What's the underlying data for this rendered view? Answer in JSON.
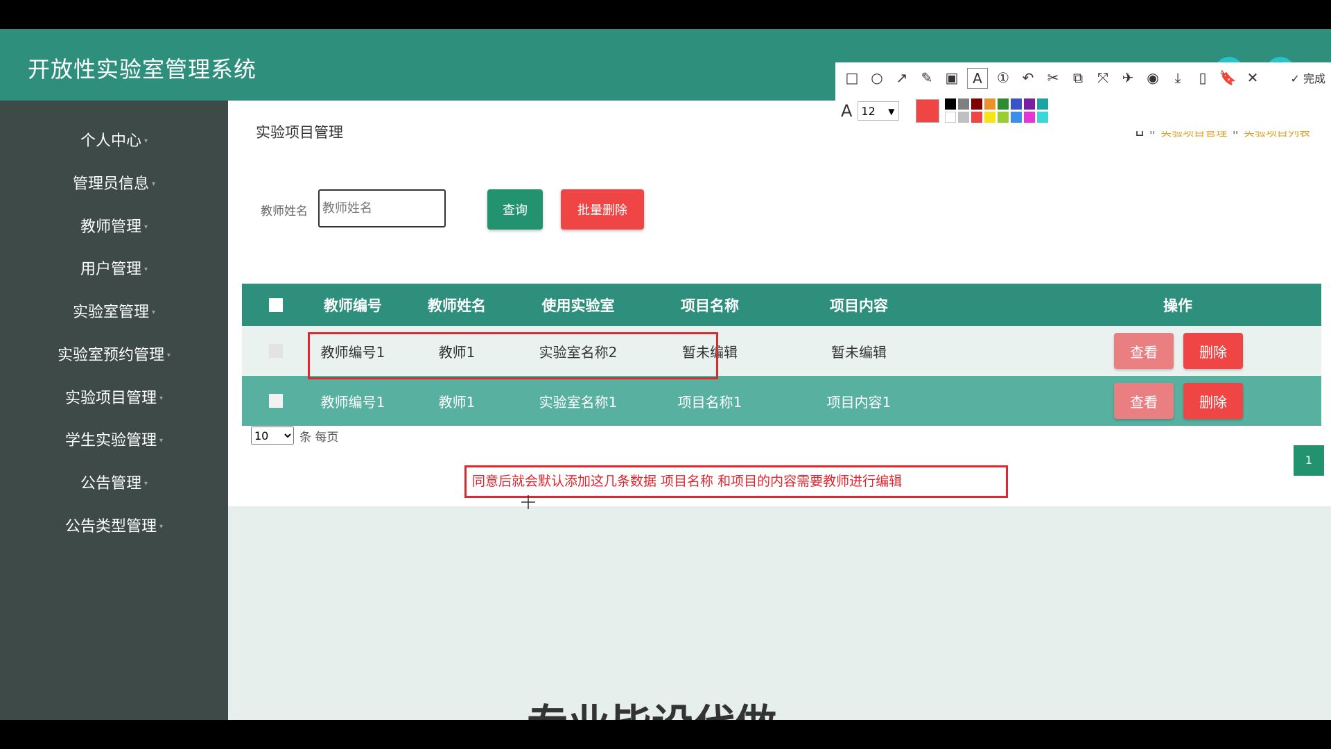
{
  "app": {
    "title": "开放性实验室管理系统"
  },
  "sidebar": {
    "items": [
      {
        "label": "个人中心"
      },
      {
        "label": "管理员信息"
      },
      {
        "label": "教师管理"
      },
      {
        "label": "用户管理"
      },
      {
        "label": "实验室管理"
      },
      {
        "label": "实验室预约管理"
      },
      {
        "label": "实验项目管理"
      },
      {
        "label": "学生实验管理"
      },
      {
        "label": "公告管理"
      },
      {
        "label": "公告类型管理"
      }
    ]
  },
  "page": {
    "title": "实验项目管理",
    "breadcrumb": [
      "实验项目管理",
      "实验项目列表"
    ],
    "search_label": "教师姓名",
    "search_placeholder": "教师姓名",
    "query_button": "查询",
    "batch_delete_button": "批量删除"
  },
  "table": {
    "headers": [
      "教师编号",
      "教师姓名",
      "使用实验室",
      "项目名称",
      "项目内容",
      "操作"
    ],
    "rows": [
      {
        "teacher_no": "教师编号1",
        "teacher_name": "教师1",
        "lab": "实验室名称2",
        "project_name": "暂未编辑",
        "project_content": "暂未编辑"
      },
      {
        "teacher_no": "教师编号1",
        "teacher_name": "教师1",
        "lab": "实验室名称1",
        "project_name": "项目名称1",
        "project_content": "项目内容1"
      }
    ],
    "view_label": "查看",
    "delete_label": "删除"
  },
  "pager": {
    "page_size": "10",
    "unit": "条 每页",
    "current_page": "1"
  },
  "annotation": "同意后就会默认添加这几条数据 项目名称 和项目的内容需要教师进行编辑",
  "toolbar": {
    "done": "完成",
    "font_size": "12"
  },
  "watermark": "专业毕设代做",
  "colors": {
    "primary": "#2f8f7d",
    "danger": "#f04545",
    "annotation": "#e0262e",
    "link": "#e0a126"
  }
}
